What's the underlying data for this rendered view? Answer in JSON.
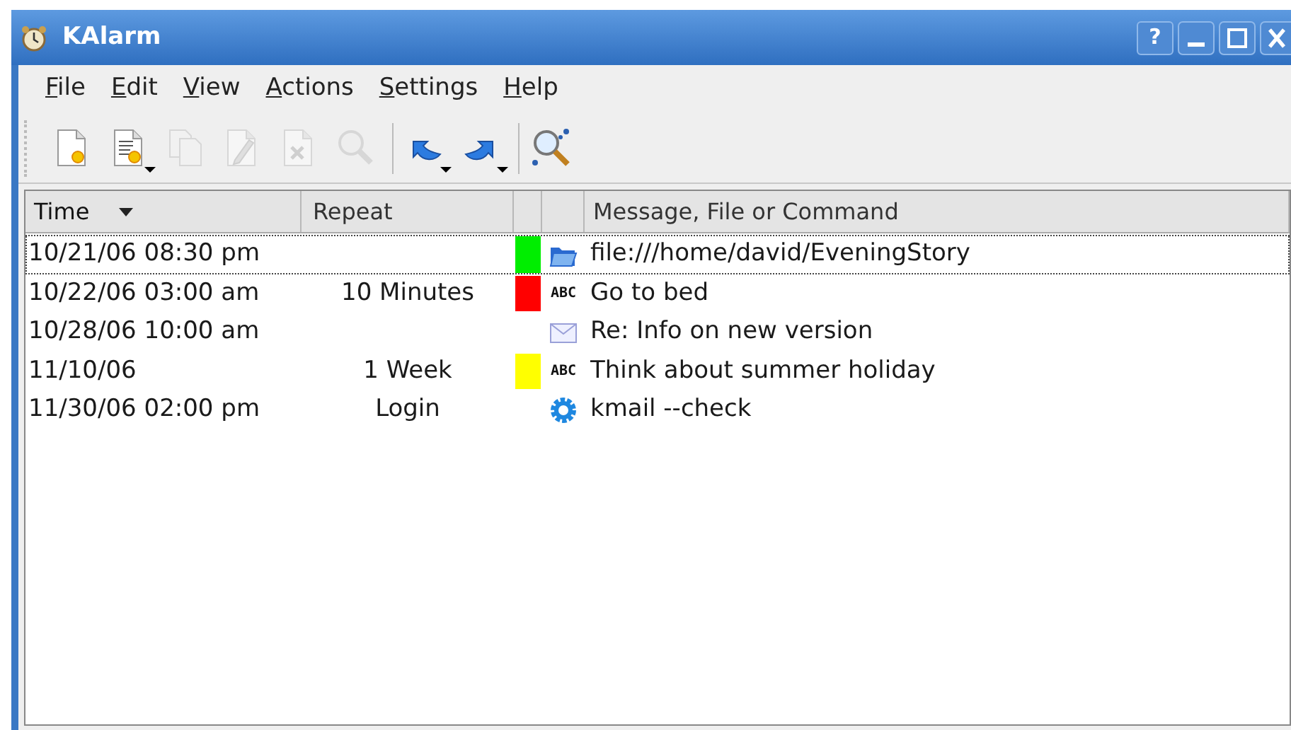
{
  "window": {
    "title": "KAlarm",
    "help_button": "?"
  },
  "menu": [
    {
      "label": "File"
    },
    {
      "label": "Edit"
    },
    {
      "label": "View"
    },
    {
      "label": "Actions"
    },
    {
      "label": "Settings"
    },
    {
      "label": "Help"
    }
  ],
  "toolbar": [
    {
      "kind": "new",
      "disabled": false,
      "has_menu": false
    },
    {
      "kind": "template",
      "disabled": false,
      "has_menu": true
    },
    {
      "kind": "copy",
      "disabled": true,
      "has_menu": false
    },
    {
      "kind": "edit",
      "disabled": true,
      "has_menu": false
    },
    {
      "kind": "delete",
      "disabled": true,
      "has_menu": false
    },
    {
      "kind": "view",
      "disabled": true,
      "has_menu": false
    },
    {
      "kind": "sep"
    },
    {
      "kind": "undo",
      "disabled": false,
      "has_menu": true
    },
    {
      "kind": "redo",
      "disabled": false,
      "has_menu": true
    },
    {
      "kind": "sep"
    },
    {
      "kind": "find",
      "disabled": false,
      "has_menu": false
    }
  ],
  "table": {
    "columns": [
      {
        "label": "Time",
        "sorted": true
      },
      {
        "label": "Repeat",
        "sorted": false
      },
      {
        "sorted": false
      },
      {
        "sorted": false
      },
      {
        "label": "Message, File or Command",
        "sorted": false
      }
    ],
    "rows": [
      {
        "time": "10/21/06 08:30 pm",
        "color": "#00ee00",
        "kind": "file",
        "message": "file:///home/david/EveningStory",
        "selected": true
      },
      {
        "time": "10/22/06 03:00 am",
        "repeat": "10 Minutes",
        "color": "#ff0000",
        "kind": "text",
        "icon_text": "ABC",
        "message": "Go to bed",
        "selected": false
      },
      {
        "time": "10/28/06 10:00 am",
        "kind": "email",
        "message": "Re: Info on new version",
        "selected": false
      },
      {
        "time": "11/10/06",
        "repeat": "1 Week",
        "color": "#ffff00",
        "kind": "text",
        "icon_text": "ABC",
        "message": "Think about summer holiday",
        "selected": false
      },
      {
        "time": "11/30/06 02:00 pm",
        "repeat": "Login",
        "kind": "command",
        "message": "kmail --check",
        "selected": false
      }
    ]
  }
}
